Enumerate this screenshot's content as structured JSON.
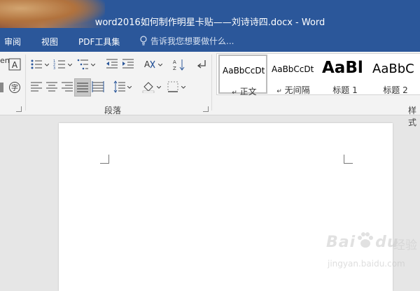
{
  "window": {
    "title": "word2016如何制作明星卡贴——刘诗诗四.docx - Word"
  },
  "tabs": [
    {
      "label": "审阅"
    },
    {
      "label": "视图"
    },
    {
      "label": "PDF工具集"
    }
  ],
  "tell_me": {
    "placeholder": "告诉我您想要做什么..."
  },
  "ribbon": {
    "font_group_partial": {
      "label_fragment": "en"
    },
    "paragraph_group": {
      "label": "段落"
    },
    "styles_group": {
      "label": "样式"
    },
    "styles": [
      {
        "sample": "AaBbCcDt",
        "name": "正文",
        "prefix": "↵",
        "active": true
      },
      {
        "sample": "AaBbCcDt",
        "name": "无间隔",
        "prefix": "↵",
        "active": false
      },
      {
        "sample": "AaBl",
        "name": "标题 1",
        "prefix": "",
        "active": false
      },
      {
        "sample": "AaBbC",
        "name": "标题 2",
        "prefix": "",
        "active": false
      }
    ]
  },
  "watermark": {
    "logo": "Bai",
    "logo2": "du",
    "sub": "经验",
    "url": "jingyan.baidu.com"
  },
  "colors": {
    "brand": "#2b579a",
    "ribbon_bg": "#f3f3f3",
    "canvas_bg": "#e6e6e6"
  }
}
